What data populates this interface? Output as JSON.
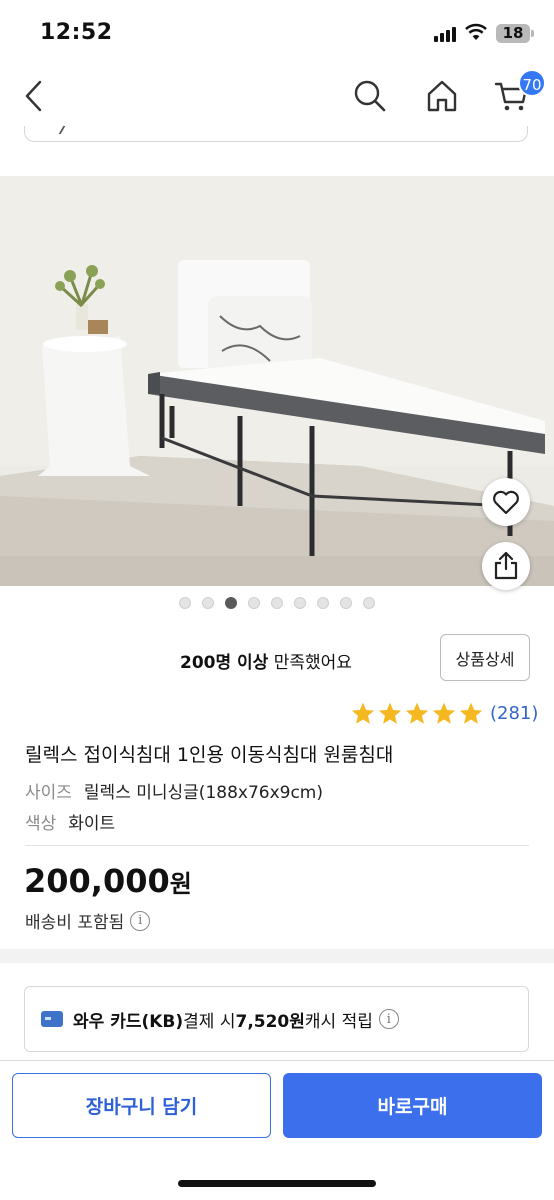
{
  "status_bar": {
    "time": "12:52",
    "battery": "18"
  },
  "nav": {
    "back_icon": "chevron-left-icon",
    "search_icon": "search-icon",
    "home_icon": "home-icon",
    "cart_icon": "cart-icon",
    "cart_count": "70"
  },
  "gallery": {
    "image_count": 9,
    "active_index": 2,
    "wish_icon": "heart-icon",
    "share_icon": "share-icon"
  },
  "satisfaction": {
    "count_text": "200명 이상",
    "rest_text": " 만족했어요",
    "detail_button": "상품상세"
  },
  "rating": {
    "stars": 5,
    "review_count": "(281)"
  },
  "product": {
    "title": "릴렉스 접이식침대 1인용 이동식침대 원룸침대",
    "size_label": "사이즈",
    "size_value": "릴렉스 미니싱글(188x76x9cm)",
    "color_label": "색상",
    "color_value": "화이트",
    "price": "200,000",
    "price_unit": "원",
    "shipping": "배송비 포함됨"
  },
  "promo": {
    "bold_text": "와우 카드(KB)",
    "middle_text": " 결제 시 ",
    "amount": "7,520원",
    "tail_text": " 캐시 적립"
  },
  "actions": {
    "cart_button": "장바구니 담기",
    "buy_button": "바로구매"
  },
  "colors": {
    "accent": "#3b6fec",
    "star": "#f5b820",
    "link": "#3365c7"
  }
}
